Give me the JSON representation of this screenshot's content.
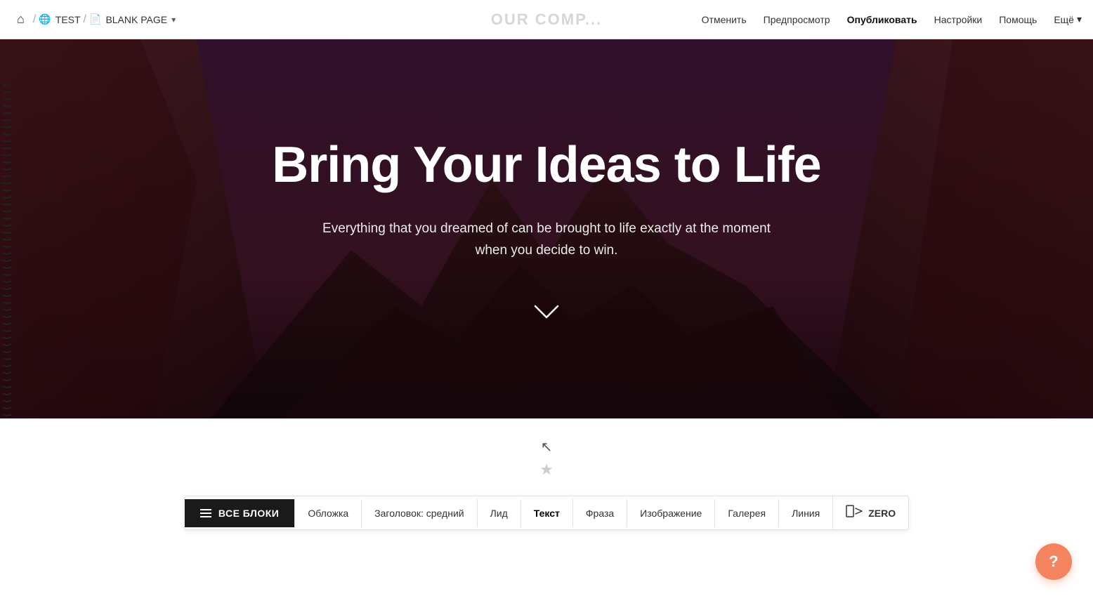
{
  "topbar": {
    "home_icon": "⌂",
    "separator": "/",
    "site_name": "TEST",
    "page_icon": "☰",
    "page_name": "BLANK PAGE",
    "page_arrow": "▾",
    "cancel_label": "Отменить",
    "preview_label": "Предпросмотр",
    "publish_label": "Опубликовать",
    "settings_label": "Настройки",
    "help_label": "Помощь",
    "more_label": "Ещё",
    "more_arrow": "▾",
    "center_logo": "OUR COMP..."
  },
  "hero": {
    "title": "Bring Your Ideas to Life",
    "subtitle": "Everything that you dreamed of can be brought to life exactly at the moment when you decide to win."
  },
  "blocks_toolbar": {
    "all_blocks_label": "ВСЕ БЛОКИ",
    "tabs": [
      {
        "label": "Обложка",
        "active": false
      },
      {
        "label": "Заголовок: средний",
        "active": false
      },
      {
        "label": "Лид",
        "active": false
      },
      {
        "label": "Текст",
        "active": true
      },
      {
        "label": "Фраза",
        "active": false
      },
      {
        "label": "Изображение",
        "active": false
      },
      {
        "label": "Галерея",
        "active": false
      },
      {
        "label": "Линия",
        "active": false
      }
    ],
    "zero_label": "ZERO"
  },
  "help": {
    "label": "?"
  }
}
